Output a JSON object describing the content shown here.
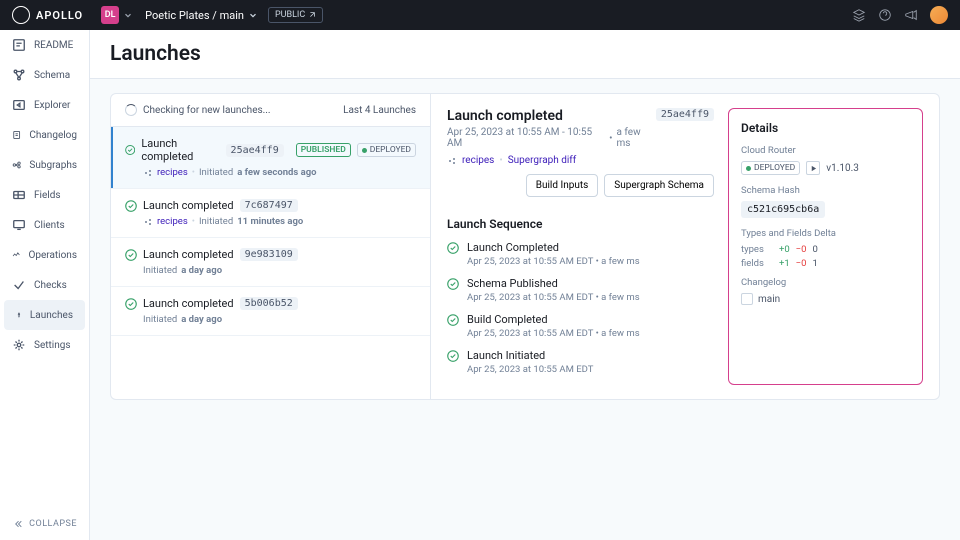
{
  "top": {
    "brand": "APOLLO",
    "org_badge": "DL",
    "crumb": "Poetic Plates / main",
    "public": "PUBLIC"
  },
  "sidebar": {
    "items": [
      "README",
      "Schema",
      "Explorer",
      "Changelog",
      "Subgraphs",
      "Fields",
      "Clients",
      "Operations",
      "Checks",
      "Launches",
      "Settings"
    ],
    "collapse": "COLLAPSE"
  },
  "page": {
    "title": "Launches"
  },
  "list": {
    "checking": "Checking for new launches...",
    "summary": "Last 4 Launches",
    "items": [
      {
        "status": "Launch completed",
        "hash": "25ae4ff9",
        "published": "PUBLISHED",
        "deployed": "DEPLOYED",
        "link": "recipes",
        "meta_prefix": "Initiated",
        "meta_time": "a few seconds ago"
      },
      {
        "status": "Launch completed",
        "hash": "7c687497",
        "link": "recipes",
        "meta_prefix": "Initiated",
        "meta_time": "11 minutes ago"
      },
      {
        "status": "Launch completed",
        "hash": "9e983109",
        "meta_prefix": "Initiated",
        "meta_time": "a day ago"
      },
      {
        "status": "Launch completed",
        "hash": "5b006b52",
        "meta_prefix": "Initiated",
        "meta_time": "a day ago"
      }
    ]
  },
  "detail": {
    "title": "Launch completed",
    "hash": "25ae4ff9",
    "time_range": "Apr 25, 2023 at 10:55 AM - 10:55 AM",
    "duration": "a few ms",
    "link1": "recipes",
    "link2": "Supergraph diff",
    "btn1": "Build Inputs",
    "btn2": "Supergraph Schema",
    "seq_title": "Launch Sequence",
    "seq": [
      {
        "name": "Launch Completed",
        "meta": "Apr 25, 2023 at 10:55 AM EDT   •   a few ms"
      },
      {
        "name": "Schema Published",
        "meta": "Apr 25, 2023 at 10:55 AM EDT   •   a few ms"
      },
      {
        "name": "Build Completed",
        "meta": "Apr 25, 2023 at 10:55 AM EDT   •   a few ms"
      },
      {
        "name": "Launch Initiated",
        "meta": "Apr 25, 2023 at 10:55 AM EDT"
      }
    ]
  },
  "panel": {
    "title": "Details",
    "router_label": "Cloud Router",
    "deployed_badge": "DEPLOYED",
    "version": "v1.10.3",
    "hash_label": "Schema Hash",
    "hash": "c521c695cb6a",
    "delta_label": "Types and Fields Delta",
    "types_label": "types",
    "types_pos": "+0",
    "types_neg": "−0",
    "types_net": "0",
    "fields_label": "fields",
    "fields_pos": "+1",
    "fields_neg": "−0",
    "fields_net": "1",
    "changelog_label": "Changelog",
    "changelog_value": "main"
  }
}
